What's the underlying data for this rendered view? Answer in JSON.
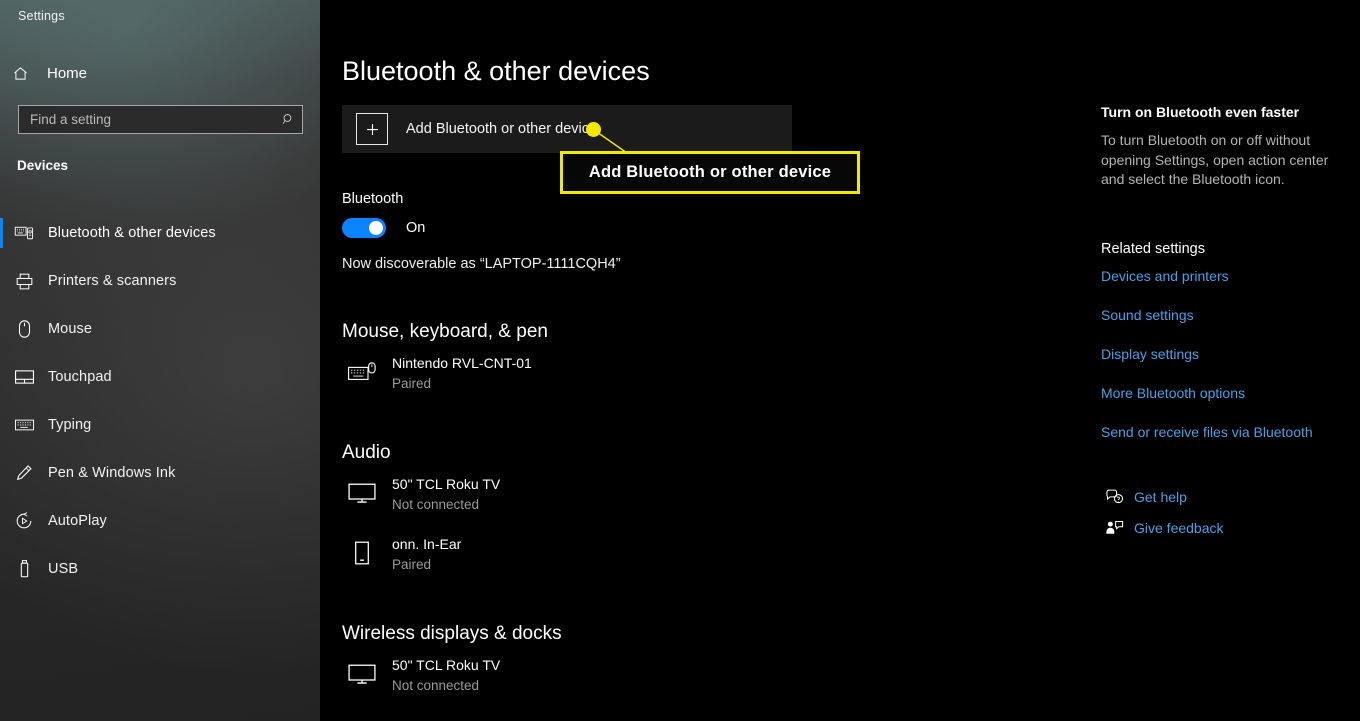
{
  "window": {
    "title": "Settings",
    "controls": [
      {
        "name": "minimize-button",
        "glyph": "minimize"
      },
      {
        "name": "restore-button",
        "glyph": "restore"
      },
      {
        "name": "close-button",
        "glyph": "close"
      }
    ]
  },
  "sidebar": {
    "home_label": "Home",
    "home_icon": "home-icon",
    "search": {
      "placeholder": "Find a setting",
      "value": "",
      "icon": "search-icon"
    },
    "group_title": "Devices",
    "items": [
      {
        "label": "Bluetooth & other devices",
        "icon": "bluetooth-devices-icon",
        "selected": true
      },
      {
        "label": "Printers & scanners",
        "icon": "printer-icon",
        "selected": false
      },
      {
        "label": "Mouse",
        "icon": "mouse-icon",
        "selected": false
      },
      {
        "label": "Touchpad",
        "icon": "touchpad-icon",
        "selected": false
      },
      {
        "label": "Typing",
        "icon": "keyboard-icon",
        "selected": false
      },
      {
        "label": "Pen & Windows Ink",
        "icon": "pen-icon",
        "selected": false
      },
      {
        "label": "AutoPlay",
        "icon": "autoplay-icon",
        "selected": false
      },
      {
        "label": "USB",
        "icon": "usb-icon",
        "selected": false
      }
    ],
    "accent_color": "#0a84ff"
  },
  "main": {
    "page_title": "Bluetooth & other devices",
    "add_device": {
      "label": "Add Bluetooth or other device",
      "icon": "plus-icon"
    },
    "bluetooth": {
      "label": "Bluetooth",
      "toggle_state": "On",
      "toggle_on": true,
      "discoverable_text": "Now discoverable as “LAPTOP-1111CQH4”"
    },
    "sections": [
      {
        "title": "Mouse, keyboard, & pen",
        "devices": [
          {
            "name": "Nintendo RVL-CNT-01",
            "status": "Paired",
            "icon": "keyboard-mouse-icon"
          }
        ]
      },
      {
        "title": "Audio",
        "devices": [
          {
            "name": "50\" TCL Roku TV",
            "status": "Not connected",
            "icon": "monitor-icon"
          },
          {
            "name": "onn. In-Ear",
            "status": "Paired",
            "icon": "phone-icon"
          }
        ]
      },
      {
        "title": "Wireless displays & docks",
        "devices": [
          {
            "name": "50\" TCL Roku TV",
            "status": "Not connected",
            "icon": "monitor-icon"
          }
        ]
      }
    ]
  },
  "right_panel": {
    "tip_title": "Turn on Bluetooth even faster",
    "tip_body": "To turn Bluetooth on or off without opening Settings, open action center and select the Bluetooth icon.",
    "related_title": "Related settings",
    "related_links": [
      "Devices and printers",
      "Sound settings",
      "Display settings",
      "More Bluetooth options",
      "Send or receive files via Bluetooth"
    ],
    "help_links": [
      {
        "label": "Get help",
        "icon": "help-chat-icon"
      },
      {
        "label": "Give feedback",
        "icon": "feedback-person-icon"
      }
    ],
    "link_color": "#4aa0e8"
  },
  "callout": {
    "text": "Add Bluetooth or other device",
    "border_color": "#f2e900",
    "dot_color": "#f2e900"
  }
}
